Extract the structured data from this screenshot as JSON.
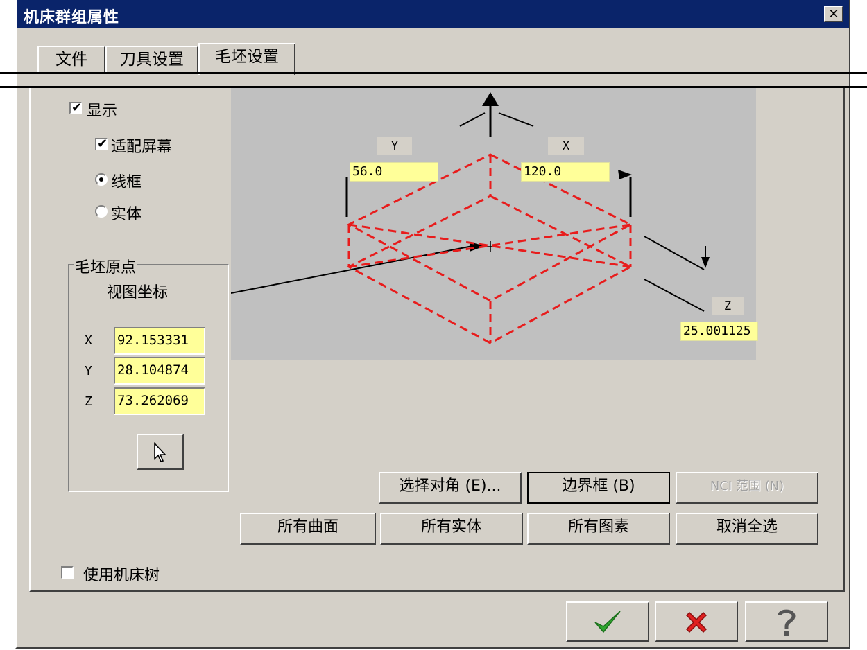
{
  "window": {
    "title": "机床群组属性",
    "close_glyph": "✕"
  },
  "tabs": [
    {
      "label": "文件"
    },
    {
      "label": "刀具设置"
    },
    {
      "label": "毛坯设置"
    }
  ],
  "display": {
    "show_label": "显示",
    "fit_screen_label": "适配屏幕",
    "wireframe_label": "线框",
    "solid_label": "实体",
    "show_checked": true,
    "fit_screen_checked": true,
    "selected_mode": "wireframe"
  },
  "origin_group": {
    "title": "毛坯原点",
    "subtitle": "视图坐标",
    "x_label": "X",
    "y_label": "Y",
    "z_label": "Z",
    "x_value": "92.153331",
    "y_value": "28.104874",
    "z_value": "73.262069"
  },
  "preview": {
    "y_axis_label": "Y",
    "x_axis_label": "X",
    "z_axis_label": "Z",
    "y_value": "56.0",
    "x_value": "120.0",
    "z_value": "25.001125",
    "colors": {
      "background": "#c0c0c0",
      "box_outline": "#e81c1c",
      "value_field": "#ffff99"
    }
  },
  "buttons": {
    "select_corner": "选择对角 (E)...",
    "bounding_box": "边界框 (B)",
    "nci_range": "NCI 范围 (N)",
    "all_surfaces": "所有曲面",
    "all_solids": "所有实体",
    "all_entities": "所有图素",
    "deselect_all": "取消全选"
  },
  "use_machine_tree": {
    "label": "使用机床树",
    "checked": false
  },
  "footer_icons": [
    "ok-checkmark-icon",
    "cancel-x-icon",
    "help-question-icon"
  ]
}
